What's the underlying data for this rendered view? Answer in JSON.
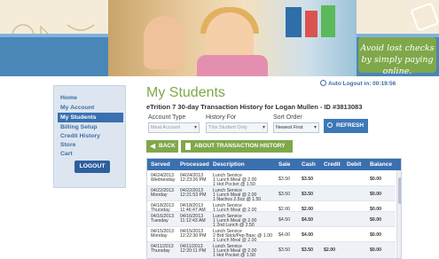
{
  "banner": {
    "tagline": "Avoid lost checks by simply paying online."
  },
  "sidebar": {
    "items": [
      {
        "label": "Home"
      },
      {
        "label": "My Account"
      },
      {
        "label": "My Students"
      },
      {
        "label": "Billing Setup"
      },
      {
        "label": "Credit History"
      },
      {
        "label": "Store"
      },
      {
        "label": "Cart"
      }
    ],
    "logout_label": "LOGOUT"
  },
  "header": {
    "auto_logout": "Auto Logout in: 00:19:56",
    "title": "My Students",
    "subtitle": "eTrition 7 30-day Transaction History for Logan Mullen - ID #3813083"
  },
  "filters": {
    "account_type": {
      "label": "Account Type",
      "value": "Meal Account"
    },
    "history_for": {
      "label": "History For",
      "value": "This Student Only"
    },
    "sort_order": {
      "label": "Sort Order",
      "value": "Newest First"
    },
    "refresh_label": "REFRESH"
  },
  "actions": {
    "back_label": "BACK",
    "about_label": "ABOUT TRANSACTION HISTORY"
  },
  "table": {
    "columns": [
      "Served",
      "Processed",
      "Description",
      "Sale",
      "Cash",
      "Credit",
      "Debit",
      "Balance"
    ],
    "rows": [
      {
        "served": [
          "04/24/2013",
          "Wednesday"
        ],
        "processed": [
          "04/24/2013",
          "12:23:26 PM"
        ],
        "description": [
          "Lunch Service",
          "1 Lunch Meal @ 2.00",
          "1 Hot Pocket @ 1.50"
        ],
        "sale": "$3.50",
        "cash": "$3.50",
        "credit": "",
        "debit": "",
        "balance": "$0.00"
      },
      {
        "served": [
          "04/22/2013",
          "Monday"
        ],
        "processed": [
          "04/22/2013",
          "12:21:53 PM"
        ],
        "description": [
          "Lunch Service",
          "1 Lunch Meal @ 2.00",
          "1 Nachos 2.5oz @ 1.50"
        ],
        "sale": "$3.50",
        "cash": "$3.50",
        "credit": "",
        "debit": "",
        "balance": "$0.00"
      },
      {
        "served": [
          "04/18/2013",
          "Thursday"
        ],
        "processed": [
          "04/18/2013",
          "11:46:47 AM"
        ],
        "description": [
          "Lunch Service",
          "1 Lunch Meal @ 2.00"
        ],
        "sale": "$2.00",
        "cash": "$2.00",
        "credit": "",
        "debit": "",
        "balance": "$0.00"
      },
      {
        "served": [
          "04/16/2013",
          "Tuesday"
        ],
        "processed": [
          "04/16/2013",
          "11:12:43 AM"
        ],
        "description": [
          "Lunch Service",
          "1 Lunch Meal @ 2.00",
          "1 2nd Lunch @ 2.50"
        ],
        "sale": "$4.50",
        "cash": "$4.50",
        "credit": "",
        "debit": "",
        "balance": "$0.00"
      },
      {
        "served": [
          "04/15/2013",
          "Monday"
        ],
        "processed": [
          "04/15/2013",
          "12:22:30 PM"
        ],
        "description": [
          "Lunch Service",
          "2 Brd Stick/Pep Basc @ 1.00",
          "1 Lunch Meal @ 2.00"
        ],
        "sale": "$4.00",
        "cash": "$4.00",
        "credit": "",
        "debit": "",
        "balance": "$0.00"
      },
      {
        "served": [
          "04/11/2013",
          "Thursday"
        ],
        "processed": [
          "04/11/2013",
          "12:20:11 PM"
        ],
        "description": [
          "Lunch Service",
          "1 Lunch Meal @ 2.00",
          "1 Hot Pocket @ 1.50"
        ],
        "sale": "$3.50",
        "cash": "$3.50",
        "credit": "$2.00",
        "debit": "",
        "balance": "$0.00"
      }
    ]
  },
  "colors": {
    "brand_green": "#7fa84a",
    "brand_blue": "#3a70b0"
  }
}
